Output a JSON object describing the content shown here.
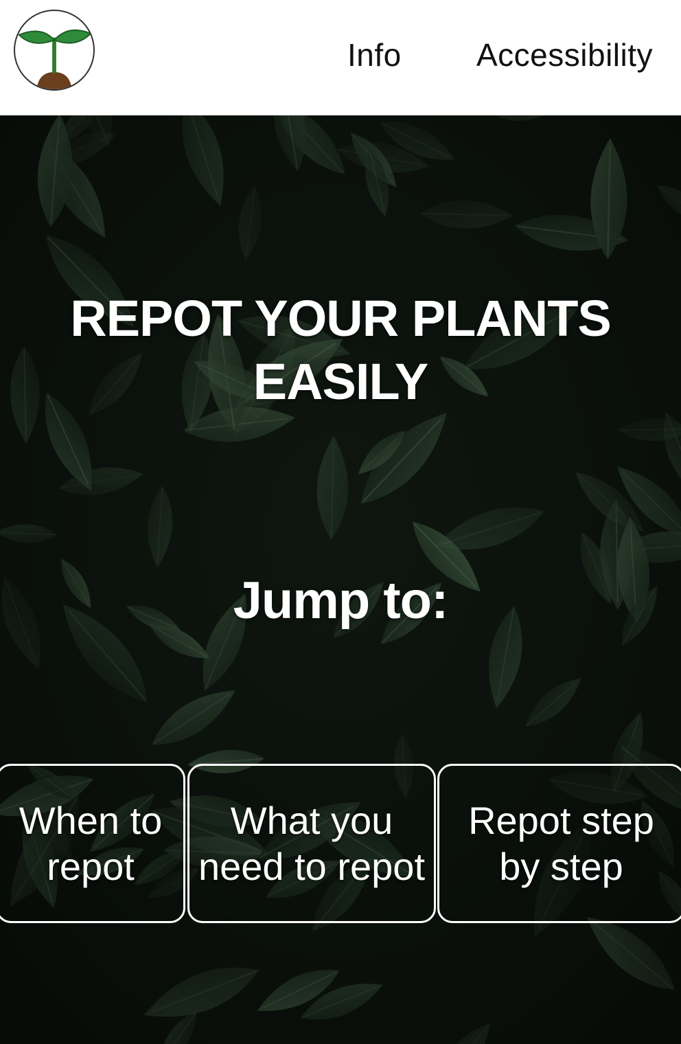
{
  "header": {
    "logo_icon": "seedling-icon",
    "nav": {
      "info_label": "Info",
      "accessibility_label": "Accessibility"
    }
  },
  "hero": {
    "background": "dark-green-leaves-photo",
    "title": "REPOT YOUR PLANTS EASILY",
    "jump_label": "Jump to:",
    "buttons": {
      "when": "When to repot",
      "what": "What you need to repot",
      "step": "Repot step by step"
    }
  },
  "colors": {
    "header_bg": "#ffffff",
    "hero_dark": "#0f1510",
    "leaf_green": "#3e5b43",
    "seedling_green": "#2e8b3a",
    "soil_brown": "#6b3e1e",
    "button_border": "#ffffff"
  }
}
